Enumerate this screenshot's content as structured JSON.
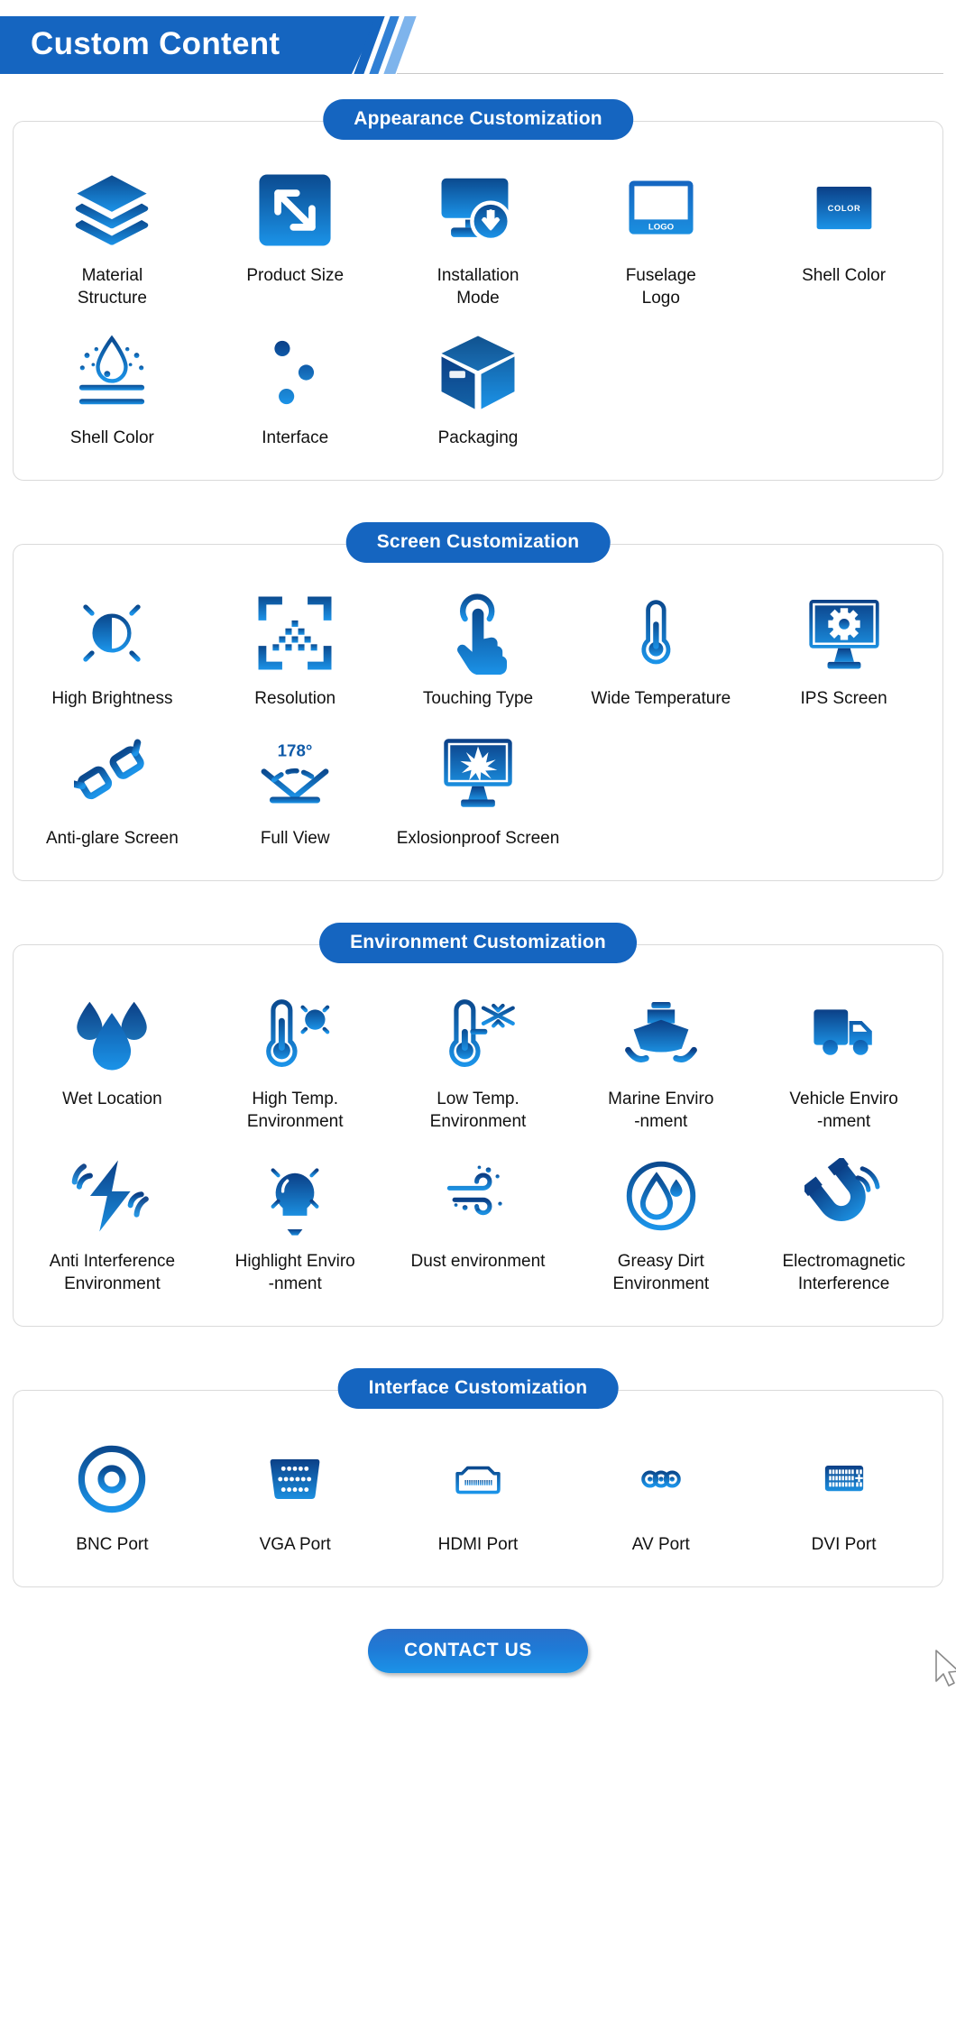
{
  "header": {
    "title": "Custom Content"
  },
  "sections": [
    {
      "id": "appearance",
      "pill": "Appearance Customization",
      "rows": [
        [
          {
            "icon": "layers-icon",
            "label": "Material\nStructure"
          },
          {
            "icon": "resize-arrow-icon",
            "label": "Product Size"
          },
          {
            "icon": "installation-download-icon",
            "label": "Installation\nMode"
          },
          {
            "icon": "monitor-logo-icon",
            "label": "Fuselage\nLogo",
            "inner_text": "LOGO"
          },
          {
            "icon": "color-swatch-icon",
            "label": "Shell Color",
            "inner_text": "COLOR"
          }
        ],
        [
          {
            "icon": "waterproof-droplet-icon",
            "label": "Shell Color"
          },
          {
            "icon": "sliders-icon",
            "label": "Interface"
          },
          {
            "icon": "package-box-icon",
            "label": "Packaging"
          }
        ]
      ]
    },
    {
      "id": "screen",
      "pill": "Screen Customization",
      "rows": [
        [
          {
            "icon": "brightness-sun-icon",
            "label": "High Brightness"
          },
          {
            "icon": "resolution-frame-icon",
            "label": "Resolution"
          },
          {
            "icon": "touch-hand-icon",
            "label": "Touching Type"
          },
          {
            "icon": "thermometer-lines-icon",
            "label": "Wide Temperature"
          },
          {
            "icon": "monitor-gear-icon",
            "label": "IPS Screen"
          }
        ],
        [
          {
            "icon": "glasses-icon",
            "label": "Anti-glare Screen"
          },
          {
            "icon": "viewing-angle-icon",
            "label": "Full View",
            "inner_text": "178°"
          },
          {
            "icon": "explosionproof-monitor-icon",
            "label": "Exlosionproof Screen"
          }
        ]
      ]
    },
    {
      "id": "environment",
      "pill": "Environment Customization",
      "rows": [
        [
          {
            "icon": "water-drops-icon",
            "label": "Wet Location"
          },
          {
            "icon": "thermometer-sun-icon",
            "label": "High Temp.\nEnvironment"
          },
          {
            "icon": "thermometer-snowflake-icon",
            "label": "Low Temp.\nEnvironment"
          },
          {
            "icon": "ship-icon",
            "label": "Marine Enviro\n-nment"
          },
          {
            "icon": "truck-icon",
            "label": "Vehicle Enviro\n-nment"
          }
        ],
        [
          {
            "icon": "lightning-waves-icon",
            "label": "Anti Interference\nEnvironment"
          },
          {
            "icon": "lightbulb-icon",
            "label": "Highlight Enviro\n-nment"
          },
          {
            "icon": "wind-dust-icon",
            "label": "Dust environment"
          },
          {
            "icon": "oil-drop-circle-icon",
            "label": "Greasy Dirt\nEnvironment"
          },
          {
            "icon": "magnet-waves-icon",
            "label": "Electromagnetic\nInterference"
          }
        ]
      ]
    },
    {
      "id": "interface",
      "pill": "Interface Customization",
      "rows": [
        [
          {
            "icon": "bnc-port-icon",
            "label": "BNC Port"
          },
          {
            "icon": "vga-port-icon",
            "label": "VGA Port"
          },
          {
            "icon": "hdmi-port-icon",
            "label": "HDMI Port"
          },
          {
            "icon": "av-port-icon",
            "label": "AV Port"
          },
          {
            "icon": "dvi-port-icon",
            "label": "DVI Port"
          }
        ]
      ]
    }
  ],
  "contact": {
    "label": "CONTACT US"
  },
  "colors": {
    "brand_blue": "#1565c0",
    "deep_blue": "#0d4a8f",
    "light_blue": "#1b93e8",
    "panel_border": "#dadada"
  }
}
